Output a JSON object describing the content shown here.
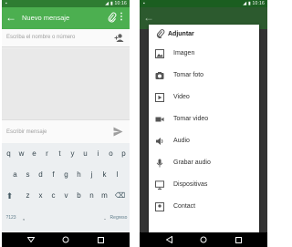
{
  "left_screen": {
    "status_bar": {
      "time": "10:16"
    },
    "app_bar": {
      "title": "Nuevo mensaje"
    },
    "recipient": {
      "placeholder": "Escriba el nombre o número"
    },
    "compose": {
      "placeholder": "Escribir mensaje"
    },
    "keyboard": {
      "row1": [
        "q",
        "w",
        "e",
        "r",
        "t",
        "y",
        "u",
        "i",
        "o",
        "p"
      ],
      "row2": [
        "a",
        "s",
        "d",
        "f",
        "g",
        "h",
        "j",
        "k",
        "l"
      ],
      "row3": [
        "z",
        "x",
        "c",
        "v",
        "b",
        "n",
        "m"
      ],
      "symbols_label": "?123",
      "comma": ",",
      "period": ".",
      "enter_label": "Regreso"
    }
  },
  "right_screen": {
    "status_bar": {
      "time": "10:16"
    },
    "attach_menu": {
      "title": "Adjuntar",
      "items": [
        {
          "label": "Imagen",
          "icon": "image-icon"
        },
        {
          "label": "Tomar foto",
          "icon": "camera-icon"
        },
        {
          "label": "Video",
          "icon": "video-icon"
        },
        {
          "label": "Tomar video",
          "icon": "videocam-icon"
        },
        {
          "label": "Audio",
          "icon": "audio-icon"
        },
        {
          "label": "Grabar audio",
          "icon": "mic-icon"
        },
        {
          "label": "Dispositivas",
          "icon": "slideshow-icon"
        },
        {
          "label": "Contact",
          "icon": "contact-icon"
        }
      ]
    }
  },
  "colors": {
    "primary": "#4caf50",
    "status_bar": "#2e7d32",
    "dimmed_primary": "#2c5a2e",
    "keyboard_bg": "#eceff1"
  }
}
